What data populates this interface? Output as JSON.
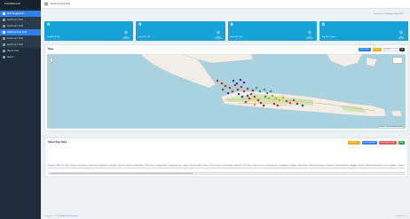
{
  "sidebar": {
    "brand": "DASHBOARD",
    "items": [
      {
        "label": "Data Pengelolaan"
      },
      {
        "label": "Dashboard 2021"
      },
      {
        "label": "Dashboard 2022"
      },
      {
        "label": "Dashboard Rig 2021"
      },
      {
        "label": "Dashboard 2023"
      },
      {
        "label": "Dashboard 2024"
      },
      {
        "label": "Master Data"
      },
      {
        "label": "Report"
      }
    ]
  },
  "topbar": {
    "breadcrumb": "Dashboard Rig 2021"
  },
  "subcrumb": {
    "home": "Dashboard",
    "current": "Dashboard Rig 2021"
  },
  "cards": [
    {
      "value": "0",
      "label": "Rig Aktif 2021"
    },
    {
      "value": "0",
      "label": "Rig 2021 TW"
    },
    {
      "value": "0",
      "label": "Rig 2021 Plan"
    },
    {
      "value": "0",
      "label": "Rig 2021 Status"
    }
  ],
  "map": {
    "title": "Map",
    "btn_filter": "Filter Data",
    "btn_export": "Export",
    "search_placeholder": "Search",
    "btn_go": "Go",
    "attribution": "Leaflet | © OpenStreetMap contributors",
    "colors": {
      "sea": "#aad3df",
      "land": "#f2efe9",
      "green": "#cfe6b8"
    }
  },
  "table": {
    "title": "Tabel Rig 2021",
    "buttons": [
      {
        "label": "Print Excel",
        "color": "#f0ad1a"
      },
      {
        "label": "Print Grafik All",
        "color": "#2f80ed"
      },
      {
        "label": "Print Grafik Detail",
        "color": "#e05b5b"
      },
      {
        "label": "Add",
        "color": "#28a745"
      }
    ],
    "columns": [
      "Regional",
      "WKP",
      "Rel",
      "Bln",
      "Platform",
      "Jml Sumur",
      "Operasi Rig",
      "Kilo Bulan",
      "Jang Rig",
      "Type Rig",
      "Kontrak",
      "Kedalaman",
      "Mulai Kerja",
      "Tanggal Mulai",
      "Tanggal Selesai",
      "Lokasi",
      "Remark",
      "Aktif",
      "Status",
      "Status Fungsi",
      "Jumlah Kerja",
      "Status PT",
      "RS",
      "Bulan",
      "Status Kerja",
      "Lokasi Kontrak",
      "Operasional",
      "Tanggal",
      "Perusahaan",
      "Nama Perusahaan",
      "Supervisi",
      "Status Verifikasi",
      "Tanggal Laporan",
      "Kedalaman Realisasi",
      "Unit",
      "Shipping",
      "Catatan"
    ]
  },
  "footer": {
    "left": "Copyright © 2021",
    "link": "Pusat Data Pertamina",
    "right": "Version 1.0.0"
  }
}
